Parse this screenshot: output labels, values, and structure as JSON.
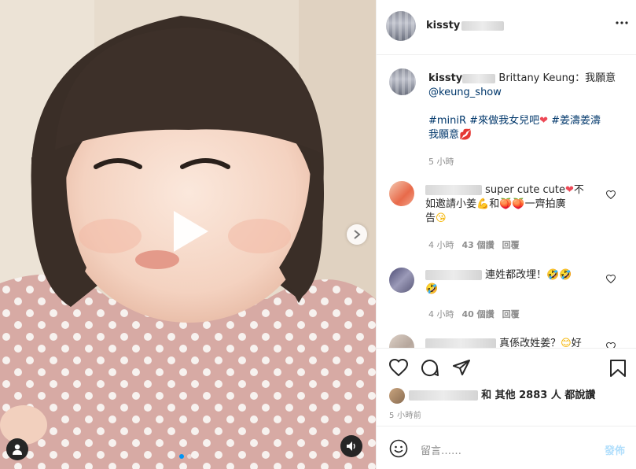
{
  "post": {
    "username": "kissty",
    "caption_author_name": "Brittany Keung：我願意",
    "caption_mention": "@keung_show",
    "caption_hashtags_line1": "#miniR #來做我女兒吧",
    "caption_hashtags_line1_tail": " #姜濤姜濤",
    "caption_line2": "我願意",
    "caption_time": "5 小時"
  },
  "comments": [
    {
      "line1": "super cute cute",
      "line1_tail": "不",
      "line2": "如邀請小姜",
      "line2_mid": "和",
      "line2_tail": "一齊拍廣",
      "line3": "告",
      "time": "4 小時",
      "likes": "43 個讚",
      "reply": "回覆"
    },
    {
      "line1": "連姓都改埋！",
      "time": "4 小時",
      "likes": "40 個讚",
      "reply": "回覆"
    },
    {
      "line1": "真係改姓姜？",
      "line1_tail": "好"
    }
  ],
  "actions": {
    "liked_by_suffix": "和 其他 2883 人 都說讚",
    "time_ago": "5 小時前"
  },
  "comment_box": {
    "placeholder": "留言……",
    "post_label": "發佈"
  },
  "colors": {
    "link": "#00376b",
    "accent": "#0095f6",
    "post_disabled": "#b2dffc",
    "heart_red": "#ed4956"
  }
}
